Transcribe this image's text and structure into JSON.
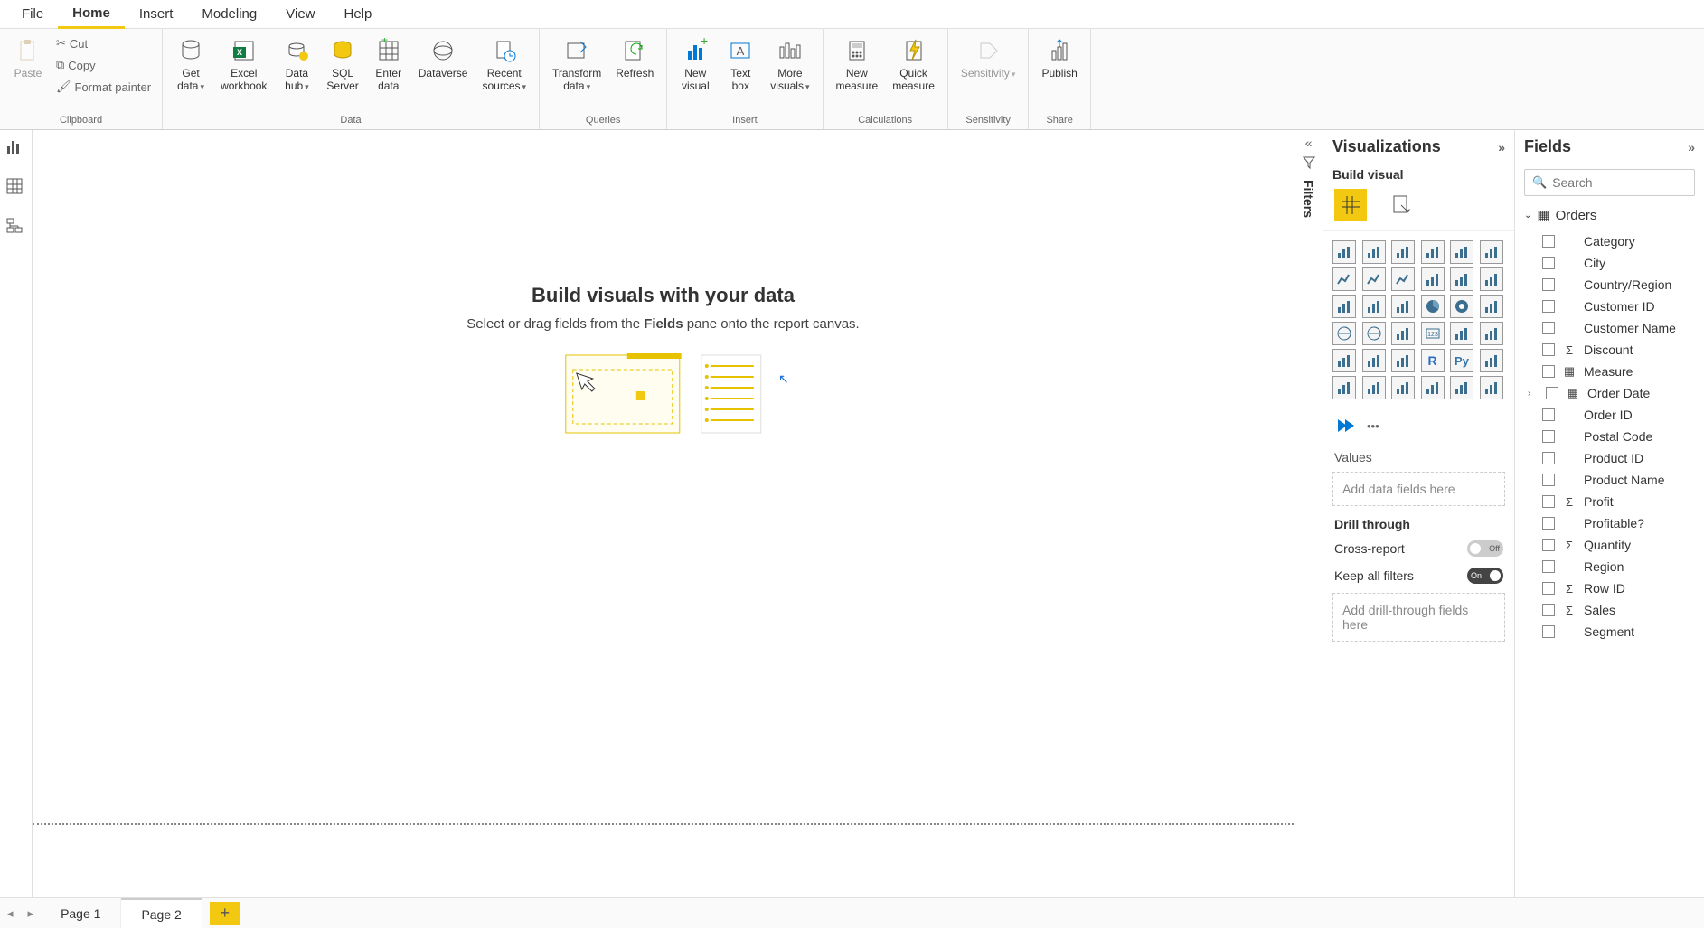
{
  "menu": {
    "file": "File",
    "home": "Home",
    "insert": "Insert",
    "modeling": "Modeling",
    "view": "View",
    "help": "Help"
  },
  "ribbon": {
    "clipboard": {
      "paste": "Paste",
      "cut": "Cut",
      "copy": "Copy",
      "format": "Format painter",
      "group": "Clipboard"
    },
    "data": {
      "getdata": "Get\ndata",
      "excel": "Excel\nworkbook",
      "datahub": "Data\nhub",
      "sql": "SQL\nServer",
      "enter": "Enter\ndata",
      "dataverse": "Dataverse",
      "recent": "Recent\nsources",
      "group": "Data"
    },
    "queries": {
      "transform": "Transform\ndata",
      "refresh": "Refresh",
      "group": "Queries"
    },
    "insert": {
      "newvisual": "New\nvisual",
      "textbox": "Text\nbox",
      "morevisuals": "More\nvisuals",
      "group": "Insert"
    },
    "calc": {
      "newmeasure": "New\nmeasure",
      "quickmeasure": "Quick\nmeasure",
      "group": "Calculations"
    },
    "sensitivity": {
      "btn": "Sensitivity",
      "group": "Sensitivity"
    },
    "share": {
      "publish": "Publish",
      "group": "Share"
    }
  },
  "canvas": {
    "title": "Build visuals with your data",
    "sub_pre": "Select or drag fields from the ",
    "sub_bold": "Fields",
    "sub_post": " pane onto the report canvas."
  },
  "filters_label": "Filters",
  "viz": {
    "title": "Visualizations",
    "subtitle": "Build visual",
    "values": "Values",
    "values_placeholder": "Add data fields here",
    "drill": "Drill through",
    "cross": "Cross-report",
    "cross_state": "Off",
    "keep": "Keep all filters",
    "keep_state": "On",
    "drill_placeholder": "Add drill-through fields here"
  },
  "viz_icons": [
    "stacked-bar",
    "stacked-column",
    "clustered-bar",
    "clustered-column",
    "100-bar",
    "100-column",
    "line",
    "area",
    "stacked-area",
    "line-column",
    "line-clustered",
    "ribbon",
    "waterfall",
    "funnel",
    "scatter",
    "pie",
    "donut",
    "treemap",
    "map",
    "filled-map",
    "arcgis",
    "card",
    "multi-card",
    "kpi",
    "slicer",
    "table",
    "matrix",
    "r-visual",
    "py-visual",
    "key-influencers",
    "decomp",
    "qna",
    "narrative",
    "paginated",
    "power-automate",
    "power-apps"
  ],
  "fields": {
    "title": "Fields",
    "search_placeholder": "Search",
    "table": "Orders",
    "items": [
      {
        "label": "Category",
        "icon": ""
      },
      {
        "label": "City",
        "icon": ""
      },
      {
        "label": "Country/Region",
        "icon": ""
      },
      {
        "label": "Customer ID",
        "icon": ""
      },
      {
        "label": "Customer Name",
        "icon": ""
      },
      {
        "label": "Discount",
        "icon": "Σ"
      },
      {
        "label": "Measure",
        "icon": "▦"
      },
      {
        "label": "Order Date",
        "icon": "▦",
        "expand": true
      },
      {
        "label": "Order ID",
        "icon": ""
      },
      {
        "label": "Postal Code",
        "icon": ""
      },
      {
        "label": "Product ID",
        "icon": ""
      },
      {
        "label": "Product Name",
        "icon": ""
      },
      {
        "label": "Profit",
        "icon": "Σ"
      },
      {
        "label": "Profitable?",
        "icon": ""
      },
      {
        "label": "Quantity",
        "icon": "Σ"
      },
      {
        "label": "Region",
        "icon": ""
      },
      {
        "label": "Row ID",
        "icon": "Σ"
      },
      {
        "label": "Sales",
        "icon": "Σ"
      },
      {
        "label": "Segment",
        "icon": ""
      }
    ]
  },
  "pages": {
    "p1": "Page 1",
    "p2": "Page 2"
  }
}
